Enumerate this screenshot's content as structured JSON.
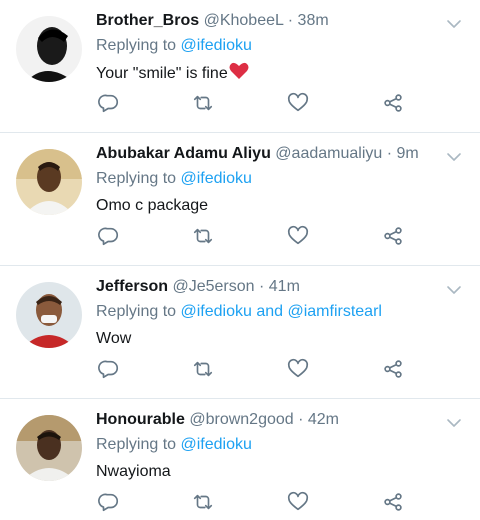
{
  "colors": {
    "link": "#1da1f2",
    "meta": "#657786",
    "text": "#14171a",
    "divider": "#e1e8ed",
    "icon": "#657786",
    "heart_emoji": "#e0245e"
  },
  "tweets": [
    {
      "name": "Brother_Bros",
      "handle": "@KhobeeL",
      "time": "· 38m",
      "replying_prefix": "Replying to ",
      "replying_to": "@ifedioku",
      "text": "Your \"smile\" is fine",
      "emoji": "heart-emoji"
    },
    {
      "name": "Abubakar Adamu Aliyu",
      "handle": "@aadamualiyu",
      "time": "· 9m",
      "replying_prefix": "Replying to ",
      "replying_to": "@ifedioku",
      "text": "Omo c package"
    },
    {
      "name": "Jefferson",
      "handle": "@Je5erson",
      "time": "· 41m",
      "replying_prefix": "Replying to ",
      "replying_to": "@ifedioku and @iamfirstearl",
      "text": "Wow"
    },
    {
      "name": "Honourable",
      "handle": "@brown2good",
      "time": "· 42m",
      "replying_prefix": "Replying to ",
      "replying_to": "@ifedioku",
      "text": "Nwayioma"
    }
  ]
}
